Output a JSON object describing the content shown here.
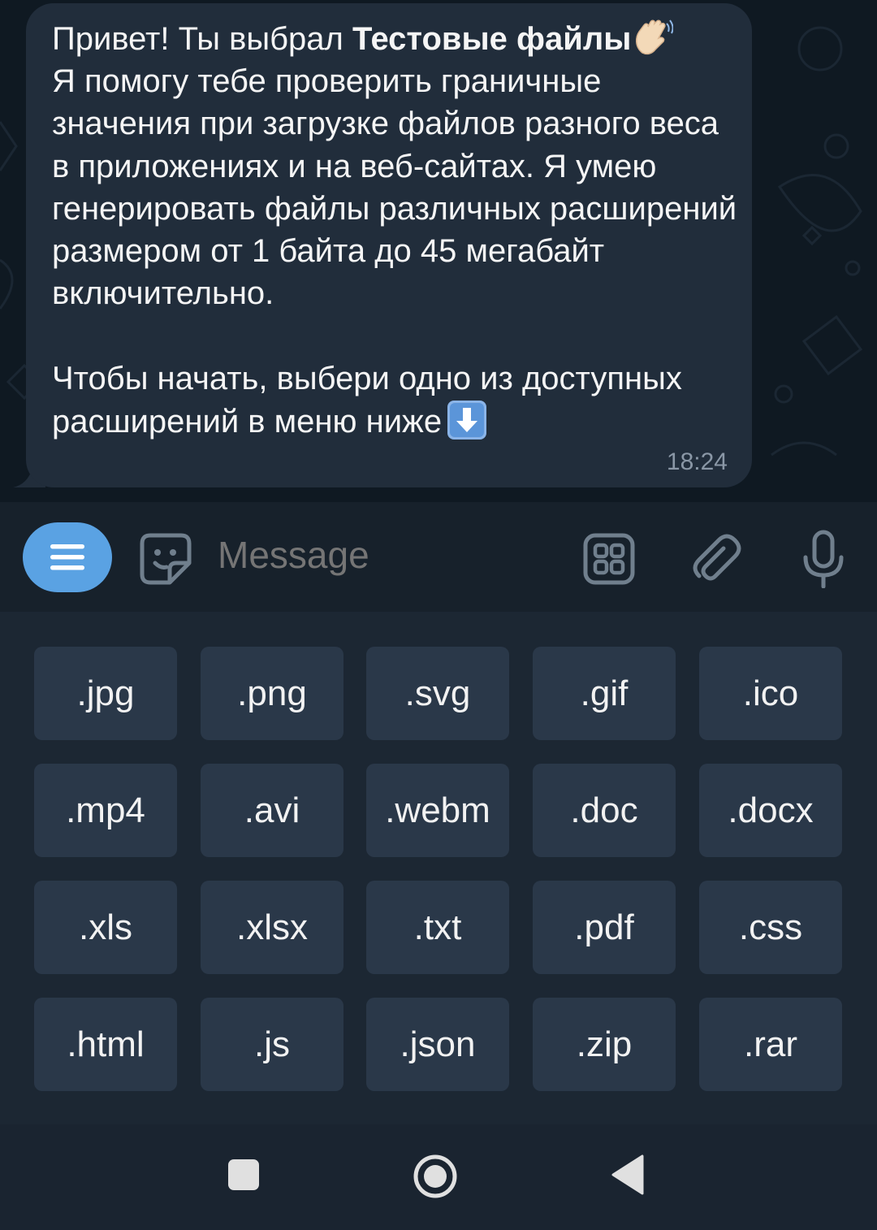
{
  "message": {
    "line1_prefix": "Привет! Ты выбрал ",
    "line1_bold": "Тестовые файлы",
    "body": "Я помогу тебе проверить граничные значения при загрузке файлов разного веса в приложениях и на веб-сайтах. Я умею генерировать файлы различных расширений размером от 1 байта до 45 мегабайт включительно.",
    "cta": "Чтобы начать, выбери одно из доступных расширений в меню ниже",
    "time": "18:24"
  },
  "input": {
    "placeholder": "Message"
  },
  "icons": {
    "menu": "menu-lines-icon",
    "sticker": "sticker-smile-icon",
    "bot_keyboard": "bot-keyboard-icon",
    "attach": "paperclip-icon",
    "mic": "microphone-icon",
    "nav_recents": "square-icon",
    "nav_home": "circle-icon",
    "nav_back": "triangle-back-icon"
  },
  "keyboard": {
    "rows": [
      [
        ".jpg",
        ".png",
        ".svg",
        ".gif",
        ".ico"
      ],
      [
        ".mp4",
        ".avi",
        ".webm",
        ".doc",
        ".docx"
      ],
      [
        ".xls",
        ".xlsx",
        ".txt",
        ".pdf",
        ".css"
      ],
      [
        ".html",
        ".js",
        ".json",
        ".zip",
        ".rar"
      ]
    ]
  },
  "colors": {
    "accent": "#5aa2e3",
    "bubble": "#212d3b",
    "keyboard_button": "#2a3849"
  }
}
